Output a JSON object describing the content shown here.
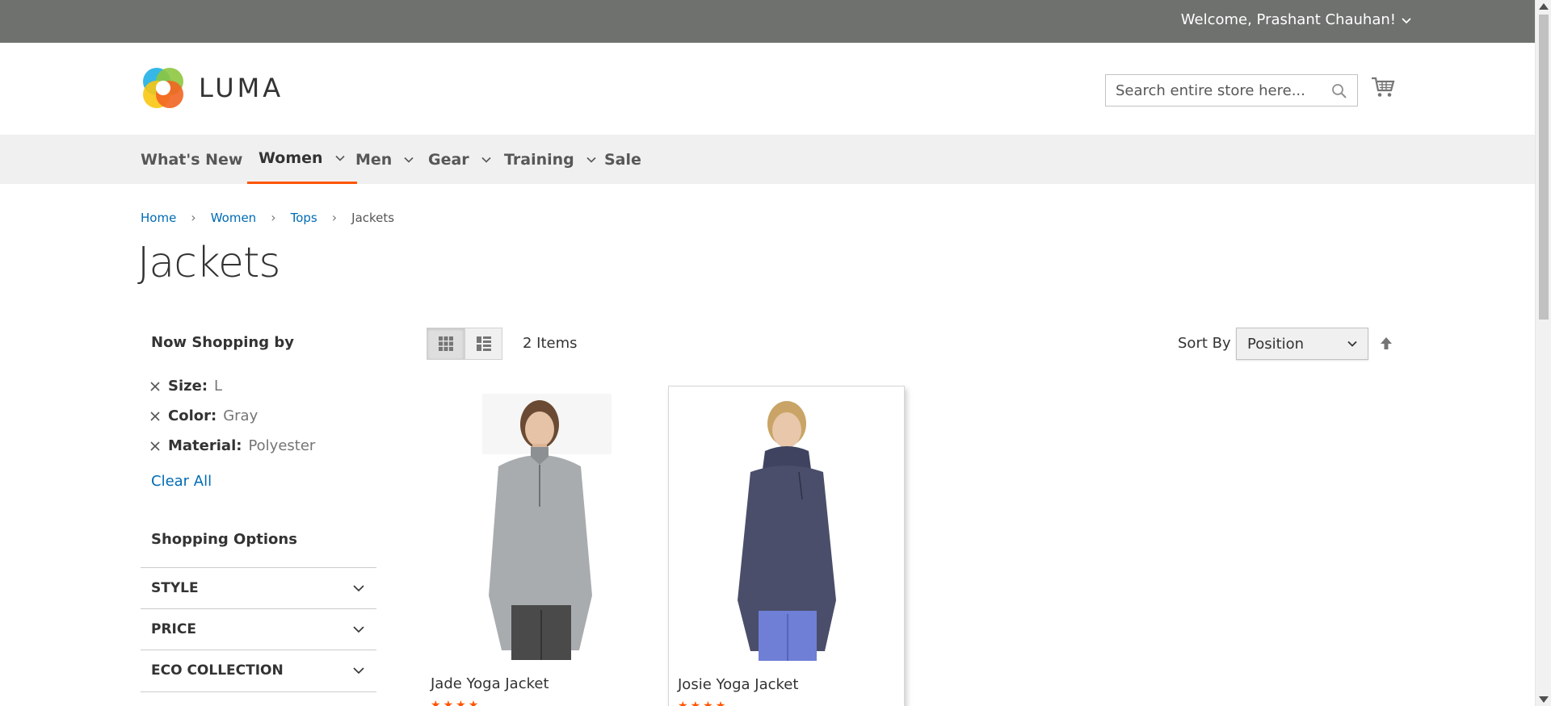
{
  "header": {
    "welcome": "Welcome, Prashant Chauhan!",
    "logo_text": "LUMA",
    "search_placeholder": "Search entire store here..."
  },
  "nav": {
    "items": [
      {
        "label": "What's New",
        "has_dropdown": false,
        "active": false
      },
      {
        "label": "Women",
        "has_dropdown": true,
        "active": true
      },
      {
        "label": "Men",
        "has_dropdown": true,
        "active": false
      },
      {
        "label": "Gear",
        "has_dropdown": true,
        "active": false
      },
      {
        "label": "Training",
        "has_dropdown": true,
        "active": false
      },
      {
        "label": "Sale",
        "has_dropdown": false,
        "active": false
      }
    ]
  },
  "breadcrumb": {
    "items": [
      "Home",
      "Women",
      "Tops"
    ],
    "current": "Jackets"
  },
  "page": {
    "title": "Jackets"
  },
  "sidebar": {
    "now_shopping_title": "Now Shopping by",
    "filters": [
      {
        "label": "Size:",
        "value": "L"
      },
      {
        "label": "Color:",
        "value": "Gray"
      },
      {
        "label": "Material:",
        "value": "Polyester"
      }
    ],
    "clear_all": "Clear All",
    "shopping_options_title": "Shopping Options",
    "options": [
      "STYLE",
      "PRICE",
      "ECO COLLECTION"
    ]
  },
  "toolbar": {
    "items_count": "2 Items",
    "sort_label": "Sort By",
    "sort_value": "Position"
  },
  "products": [
    {
      "name": "Jade Yoga Jacket",
      "color": "#a9acaf"
    },
    {
      "name": "Josie Yoga Jacket",
      "color": "#4a4e6a"
    }
  ],
  "colors": {
    "top_bar": "#6e716e",
    "accent": "#ff5501",
    "link": "#006bb4",
    "nav_bg": "#f0f0f0"
  }
}
